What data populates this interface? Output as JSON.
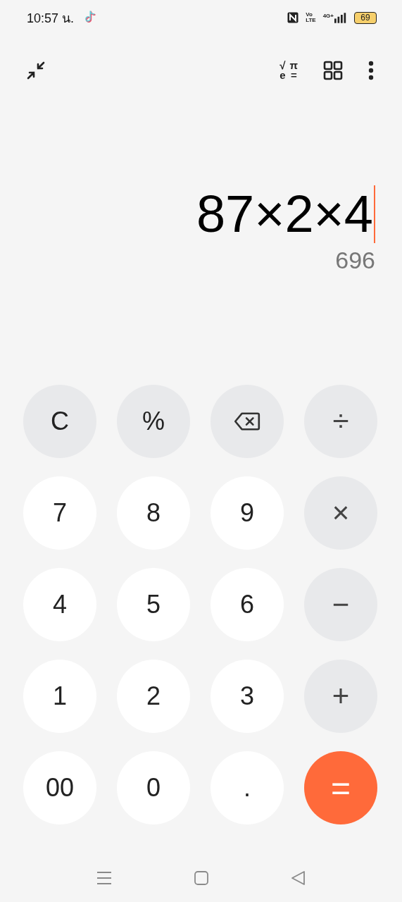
{
  "status_bar": {
    "time": "10:57 น.",
    "volte_top": "Vo",
    "volte_bottom": "LTE",
    "network": "4G+",
    "battery": "69"
  },
  "toolbar": {
    "scientific_symbols": [
      "√",
      "π",
      "e",
      "="
    ]
  },
  "display": {
    "expression": "87×2×4",
    "result": "696"
  },
  "keys": [
    {
      "kind": "function",
      "label": "C"
    },
    {
      "kind": "function",
      "label": "%"
    },
    {
      "kind": "backspace"
    },
    {
      "kind": "operator",
      "label": "÷"
    },
    {
      "kind": "digit",
      "label": "7"
    },
    {
      "kind": "digit",
      "label": "8"
    },
    {
      "kind": "digit",
      "label": "9"
    },
    {
      "kind": "operator",
      "label": "×"
    },
    {
      "kind": "digit",
      "label": "4"
    },
    {
      "kind": "digit",
      "label": "5"
    },
    {
      "kind": "digit",
      "label": "6"
    },
    {
      "kind": "operator",
      "label": "−"
    },
    {
      "kind": "digit",
      "label": "1"
    },
    {
      "kind": "digit",
      "label": "2"
    },
    {
      "kind": "digit",
      "label": "3"
    },
    {
      "kind": "operator",
      "label": "+"
    },
    {
      "kind": "digit",
      "label": "00"
    },
    {
      "kind": "digit",
      "label": "0"
    },
    {
      "kind": "digit",
      "label": "."
    },
    {
      "kind": "equals",
      "label": "="
    }
  ]
}
